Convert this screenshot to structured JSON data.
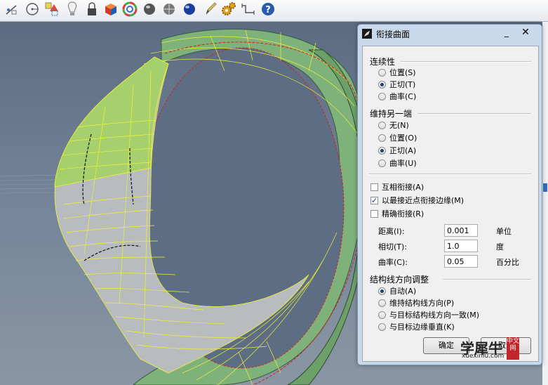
{
  "colors": {
    "accent": "#1d3d75",
    "viewport_top": "#5b6b82",
    "surface_green": "#7fb27a",
    "seam_red": "#d42020",
    "isocurve_yellow": "#f2f230"
  },
  "toolbar": {
    "icons": [
      "grid-snap-icon",
      "circle-tool-icon",
      "shapes-icon",
      "lightbulb-icon",
      "lock-icon",
      "render-cube-icon",
      "color-wheel-icon",
      "sphere-icon",
      "sphere-grid-icon",
      "blue-sphere-icon",
      "pencil-icon",
      "gear-cluster-icon",
      "dimension-icon",
      "help-icon"
    ]
  },
  "dialog": {
    "title": "衔接曲面",
    "min_label": "_",
    "close_label": "✕",
    "continuity": {
      "heading": "连续性",
      "options": [
        {
          "label": "位置(S)",
          "selected": false
        },
        {
          "label": "正切(T)",
          "selected": true
        },
        {
          "label": "曲率(C)",
          "selected": false
        }
      ]
    },
    "maintain": {
      "heading": "维持另一端",
      "options": [
        {
          "label": "无(N)",
          "selected": false
        },
        {
          "label": "位置(O)",
          "selected": false
        },
        {
          "label": "正切(A)",
          "selected": true
        },
        {
          "label": "曲率(U)",
          "selected": false
        }
      ]
    },
    "checks": [
      {
        "label": "互相衔接(A)",
        "checked": false
      },
      {
        "label": "以最接近点衔接边缘(M)",
        "checked": true
      },
      {
        "label": "精确衔接(R)",
        "checked": false
      }
    ],
    "tolerances": [
      {
        "label": "距离(I):",
        "value": "0.001",
        "unit": "单位"
      },
      {
        "label": "相切(T):",
        "value": "1.0",
        "unit": "度"
      },
      {
        "label": "曲率(C):",
        "value": "0.05",
        "unit": "百分比"
      }
    ],
    "isocurve": {
      "heading": "结构线方向调整",
      "options": [
        {
          "label": "自动(A)",
          "selected": true
        },
        {
          "label": "维持结构线方向(P)",
          "selected": false
        },
        {
          "label": "与目标结构线方向一致(M)",
          "selected": false
        },
        {
          "label": "与目标边缘垂直(K)",
          "selected": false
        }
      ]
    },
    "ok_label": "确定",
    "cancel_label": "取消"
  },
  "watermark": {
    "text": "学犀牛",
    "seal": "中文网",
    "url": "xuexiniu.com"
  }
}
